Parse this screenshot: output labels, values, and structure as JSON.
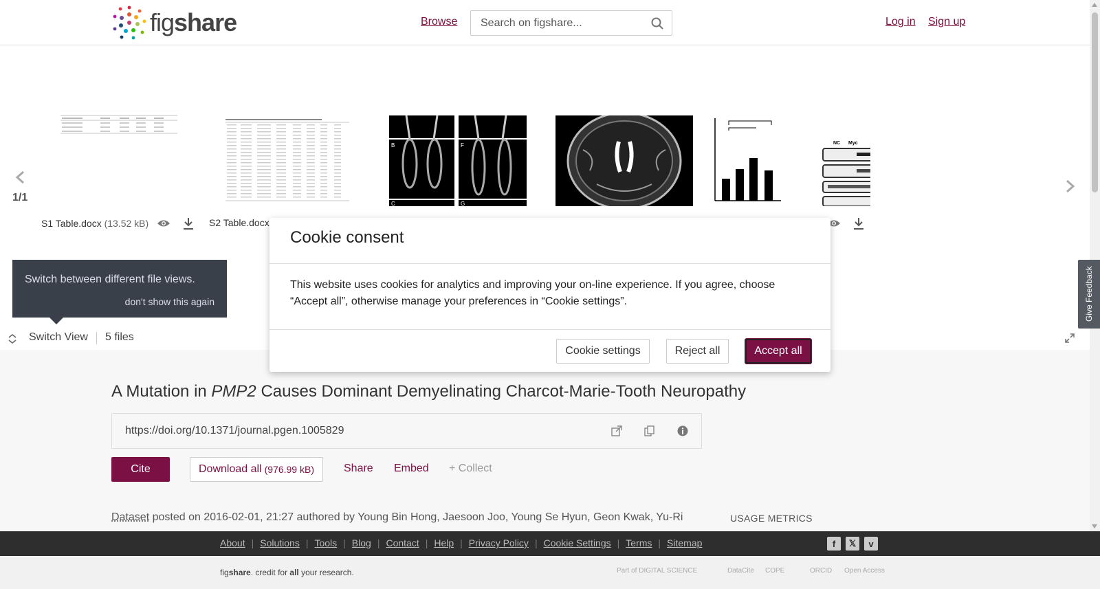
{
  "header": {
    "logo_text_prefix": "fig",
    "logo_text_suffix": "share",
    "browse_label": "Browse",
    "search_placeholder": "Search on figshare...",
    "login_label": "Log in",
    "signup_label": "Sign up"
  },
  "carousel": {
    "page_indicator": "1/1",
    "files": [
      {
        "name": "S1 Table.docx",
        "size": "(13.52 kB)"
      },
      {
        "name": "S2 Table.docx",
        "size": ""
      }
    ]
  },
  "tooltip": {
    "text": "Switch between different file views.",
    "dismiss": "don't show this again"
  },
  "switch_bar": {
    "switch_view_label": "Switch View",
    "files_count": "5 files"
  },
  "article": {
    "title_prefix": "A Mutation in ",
    "title_gene": "PMP2",
    "title_suffix": " Causes Dominant Demyelinating Charcot-Marie-Tooth Neuropathy",
    "doi": "https://doi.org/10.1371/journal.pgen.1005829",
    "cite_label": "Cite",
    "download_label": "Download all",
    "download_size": "(976.99 kB)",
    "share_label": "Share",
    "embed_label": "Embed",
    "collect_label": "+ Collect",
    "data_type": "Dataset",
    "posted_text": " posted on 2016-02-01, 21:27 authored by Young Bin Hong, Jaesoon Joo, Young Se Hyun, Geon Kwak, Yu-Ri",
    "usage_metrics_label": "USAGE METRICS"
  },
  "cookie_modal": {
    "title": "Cookie consent",
    "body": "This website uses cookies for analytics and improving your on-line experience. If you agree, choose “Accept all”, otherwise manage your preferences in “Cookie settings”.",
    "settings_label": "Cookie settings",
    "reject_label": "Reject all",
    "accept_label": "Accept all"
  },
  "feedback_label": "Give Feedback",
  "footer": {
    "nav": [
      "About",
      "Solutions",
      "Tools",
      "Blog",
      "Contact",
      "Help",
      "Privacy Policy",
      "Cookie Settings",
      "Terms",
      "Sitemap"
    ],
    "social": [
      "facebook-icon",
      "x-icon",
      "vimeo-icon"
    ],
    "tagline_fig": "fig",
    "tagline_share": "share",
    "tagline_rest": ". credit for ",
    "tagline_all": "all",
    "tagline_end": " your research.",
    "partners": [
      "Part of DIGITAL SCIENCE",
      "DataCite",
      "COPE",
      "ORCID",
      "Open Access"
    ]
  },
  "colors": {
    "brand": "#7a1043",
    "footer_dark": "#2e2e2e"
  }
}
